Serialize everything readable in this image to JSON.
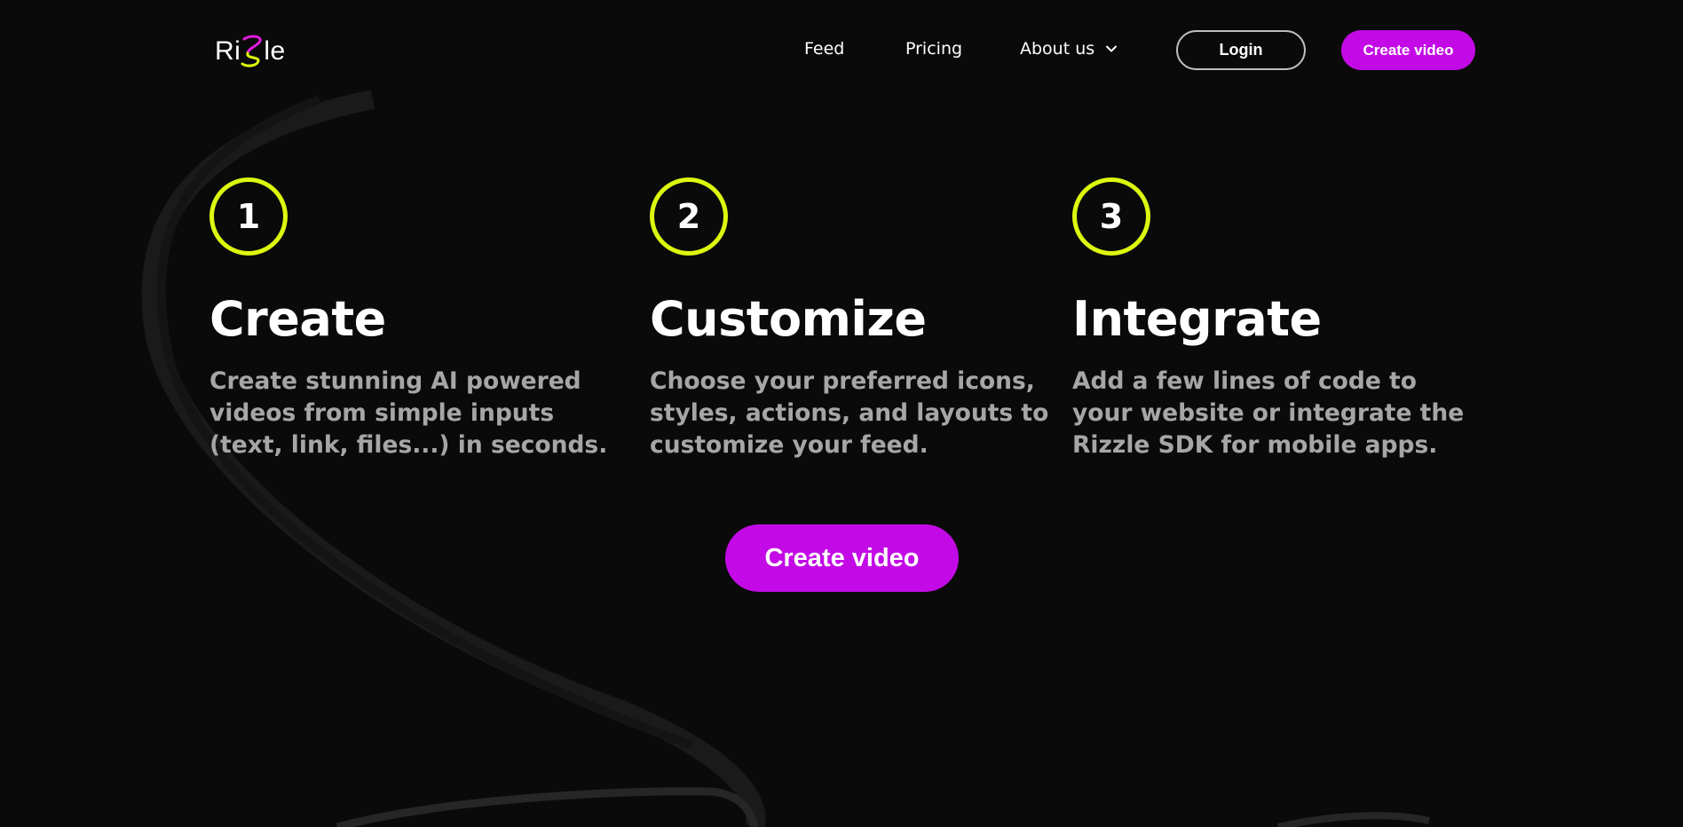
{
  "brand": {
    "logo_prefix": "Ri",
    "logo_suffix": "le",
    "logo_colors": {
      "pink": "#e21be0",
      "lime": "#dcf80f"
    }
  },
  "nav": {
    "feed_label": "Feed",
    "pricing_label": "Pricing",
    "about_label": "About us",
    "about_icon": "chevron-down-icon",
    "login_label": "Login",
    "create_label": "Create video"
  },
  "steps": [
    {
      "number": "1",
      "title": "Create",
      "description": "Create stunning AI powered videos from simple inputs (text, link, files...) in seconds."
    },
    {
      "number": "2",
      "title": "Customize",
      "description": "Choose your preferred icons, styles, actions, and layouts to customize your feed."
    },
    {
      "number": "3",
      "title": "Integrate",
      "description": "Add a few lines of code to your website or integrate the Rizzle SDK for mobile apps."
    }
  ],
  "cta": {
    "label": "Create video"
  },
  "colors": {
    "background": "#0a0a0a",
    "accent_purple": "#c30ae6",
    "accent_lime": "#dcf80f",
    "muted_text": "#a6a6a6"
  }
}
